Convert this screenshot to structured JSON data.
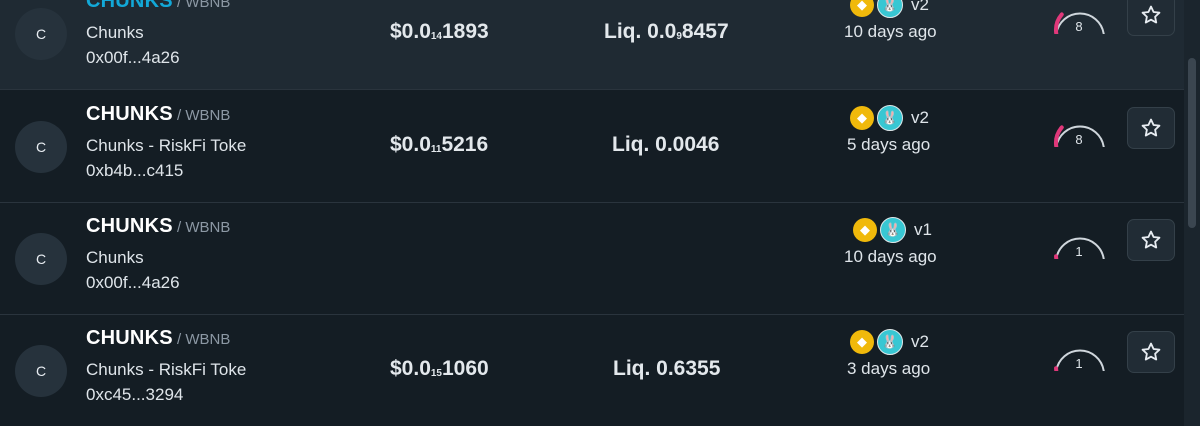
{
  "rows": [
    {
      "avatar": "C",
      "symbol": "CHUNKS",
      "pair": "/ WBNB",
      "name": "Chunks",
      "address": "0x00f...4a26",
      "price": {
        "prefix": "$0.0",
        "zeros": "14",
        "digits": "1893"
      },
      "liquidity": {
        "prefix": "Liq. 0.0",
        "zeros": "9",
        "digits": "8457"
      },
      "version": "v2",
      "age": "10 days ago",
      "score": "8",
      "score_fraction": 0.25
    },
    {
      "avatar": "C",
      "symbol": "CHUNKS",
      "pair": "/ WBNB",
      "name": "Chunks - RiskFi Toke",
      "address": "0xb4b...c415",
      "price": {
        "prefix": "$0.0",
        "zeros": "11",
        "digits": "5216"
      },
      "liquidity": {
        "prefix": "Liq. 0.0046",
        "zeros": "",
        "digits": ""
      },
      "version": "v2",
      "age": "5 days ago",
      "score": "8",
      "score_fraction": 0.25
    },
    {
      "avatar": "C",
      "symbol": "CHUNKS",
      "pair": "/ WBNB",
      "name": "Chunks",
      "address": "0x00f...4a26",
      "price": {
        "prefix": "",
        "zeros": "",
        "digits": ""
      },
      "liquidity": {
        "prefix": "",
        "zeros": "",
        "digits": ""
      },
      "version": "v1",
      "age": "10 days ago",
      "score": "1",
      "score_fraction": 0.03
    },
    {
      "avatar": "C",
      "symbol": "CHUNKS",
      "pair": "/ WBNB",
      "name": "Chunks - RiskFi Toke",
      "address": "0xc45...3294",
      "price": {
        "prefix": "$0.0",
        "zeros": "15",
        "digits": "1060"
      },
      "liquidity": {
        "prefix": "Liq. 0.6355",
        "zeros": "",
        "digits": ""
      },
      "version": "v2",
      "age": "3 days ago",
      "score": "1",
      "score_fraction": 0.03
    }
  ],
  "icons": {
    "chain": "bnb-chain-icon",
    "dex": "pancakeswap-icon",
    "favorite": "star-icon"
  },
  "colors": {
    "accent": "#12a8d8",
    "gauge_fill": "#e0387a",
    "gauge_track": "#cfd6dc"
  }
}
